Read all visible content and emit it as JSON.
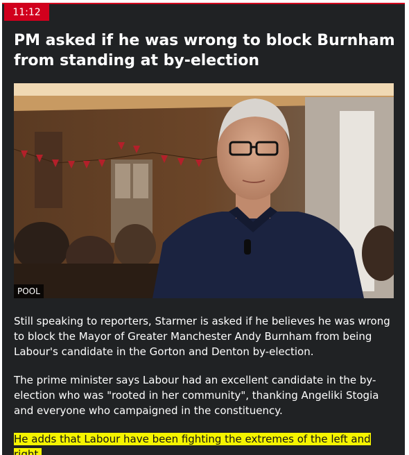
{
  "post": {
    "time": "11:12",
    "headline": "PM asked if he was wrong to block Burnham from standing at by-election",
    "image_credit": "POOL",
    "paragraphs": [
      "Still speaking to reporters, Starmer is asked if he believes he was wrong to block the Mayor of Greater Manchester Andy Burnham from being Labour's candidate in the Gorton and Denton by-election.",
      "The prime minister says Labour had an excellent candidate in the by-election who was \"rooted in her community\", thanking Angeliki Stogia and everyone who campaigned in the constituency."
    ],
    "highlighted_paragraph": "He adds that Labour have been fighting the extremes of the left and right."
  },
  "colors": {
    "accent_red": "#d1001d",
    "card_background": "#202224",
    "highlight_yellow": "#f5f400"
  }
}
